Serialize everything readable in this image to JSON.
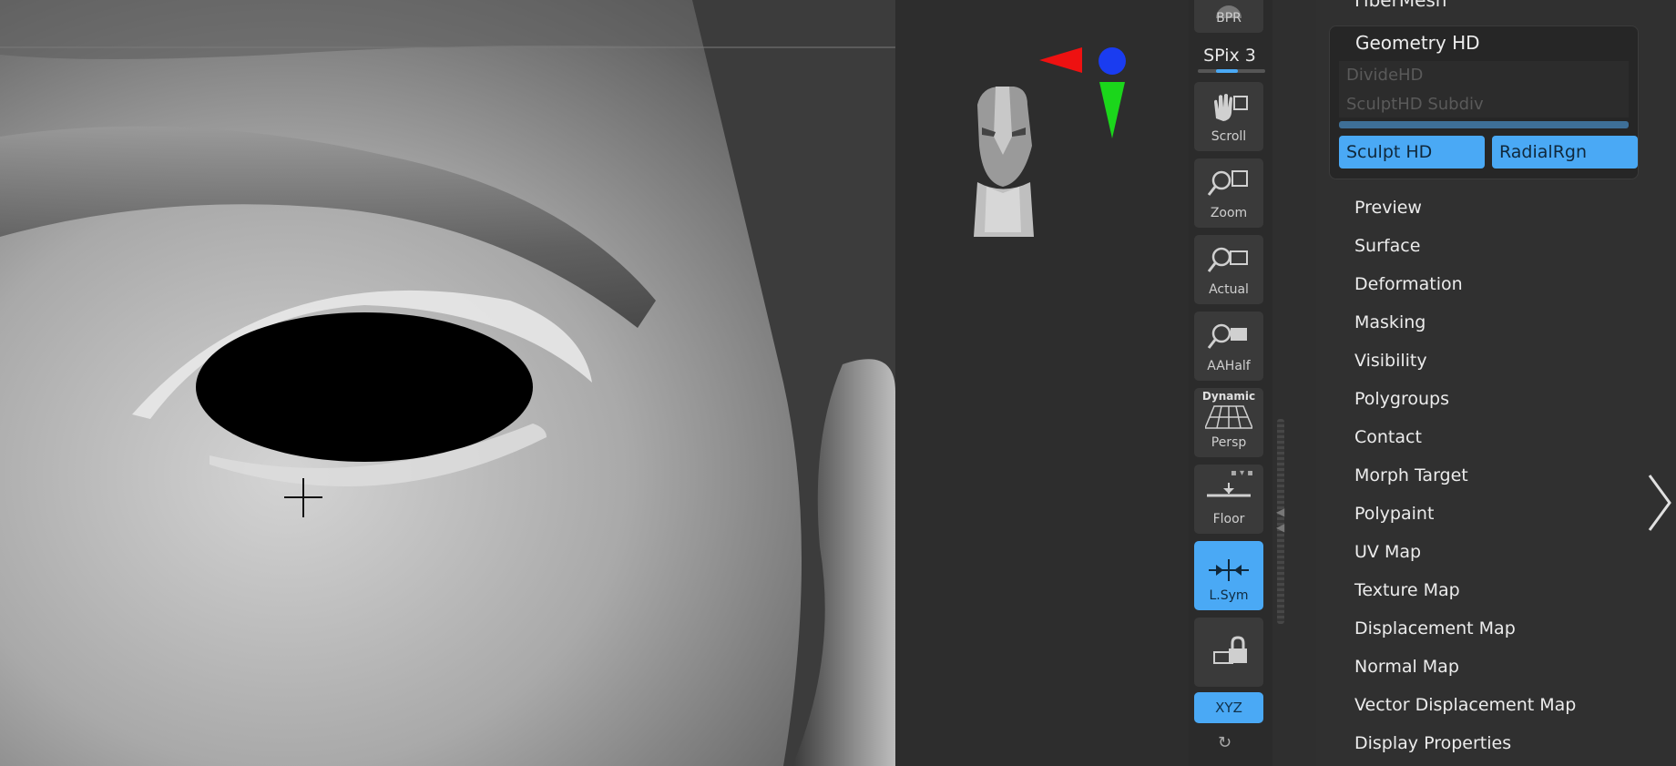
{
  "shelf": {
    "bpr_label": "BPR",
    "spix_label": "SPix 3",
    "buttons": [
      {
        "label": "Scroll",
        "icon": "hand-icon"
      },
      {
        "label": "Zoom",
        "icon": "magnifier-icon"
      },
      {
        "label": "Actual",
        "icon": "magnifier-icon"
      },
      {
        "label": "AAHalf",
        "icon": "magnifier-icon"
      },
      {
        "label": "Persp",
        "top_label": "Dynamic",
        "icon": "perspective-grid-icon"
      },
      {
        "label": "Floor",
        "icon": "floor-icon"
      },
      {
        "label": "L.Sym",
        "icon": "symmetry-icon"
      },
      {
        "label": "",
        "icon": "lock-icon"
      }
    ],
    "xyz_label": "XYZ",
    "accent": "#4aa9f5"
  },
  "panel": {
    "fibermesh_label": "FiberMesh",
    "geometry_hd": {
      "title": "Geometry HD",
      "disabled_rows": [
        "DivideHD",
        "SculptHD Subdiv"
      ],
      "buttons": [
        "Sculpt HD",
        "RadialRgn"
      ]
    },
    "menu_items": [
      "Preview",
      "Surface",
      "Deformation",
      "Masking",
      "Visibility",
      "Polygroups",
      "Contact",
      "Morph Target",
      "Polypaint",
      "UV Map",
      "Texture Map",
      "Displacement Map",
      "Normal Map",
      "Vector Displacement Map",
      "Display Properties"
    ]
  }
}
